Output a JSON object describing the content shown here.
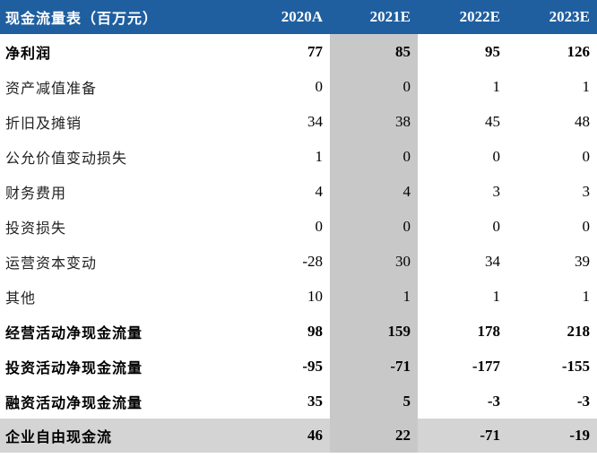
{
  "table": {
    "header": {
      "label": "现金流量表（百万元）",
      "years": [
        "2020A",
        "2021E",
        "2022E",
        "2023E"
      ]
    },
    "rows": [
      {
        "label": "净利润",
        "values": [
          "77",
          "85",
          "95",
          "126"
        ],
        "bold": true
      },
      {
        "label": "资产减值准备",
        "values": [
          "0",
          "0",
          "1",
          "1"
        ],
        "bold": false
      },
      {
        "label": "折旧及摊销",
        "values": [
          "34",
          "38",
          "45",
          "48"
        ],
        "bold": false
      },
      {
        "label": "公允价值变动损失",
        "values": [
          "1",
          "0",
          "0",
          "0"
        ],
        "bold": false
      },
      {
        "label": "财务费用",
        "values": [
          "4",
          "4",
          "3",
          "3"
        ],
        "bold": false
      },
      {
        "label": "投资损失",
        "values": [
          "0",
          "0",
          "0",
          "0"
        ],
        "bold": false
      },
      {
        "label": "运营资本变动",
        "values": [
          "-28",
          "30",
          "34",
          "39"
        ],
        "bold": false
      },
      {
        "label": "其他",
        "values": [
          "10",
          "1",
          "1",
          "1"
        ],
        "bold": false
      },
      {
        "label": "经营活动净现金流量",
        "values": [
          "98",
          "159",
          "178",
          "218"
        ],
        "bold": true
      },
      {
        "label": "投资活动净现金流量",
        "values": [
          "-95",
          "-71",
          "-177",
          "-155"
        ],
        "bold": true
      },
      {
        "label": "融资活动净现金流量",
        "values": [
          "35",
          "5",
          "-3",
          "-3"
        ],
        "bold": true
      },
      {
        "label": "企业自由现金流",
        "values": [
          "46",
          "22",
          "-71",
          "-19"
        ],
        "bold": true,
        "total": true
      }
    ]
  },
  "colors": {
    "header_bg": "#1f5fa0",
    "highlight_col": "#c8c8c8",
    "total_row": "#d4d4d4"
  }
}
